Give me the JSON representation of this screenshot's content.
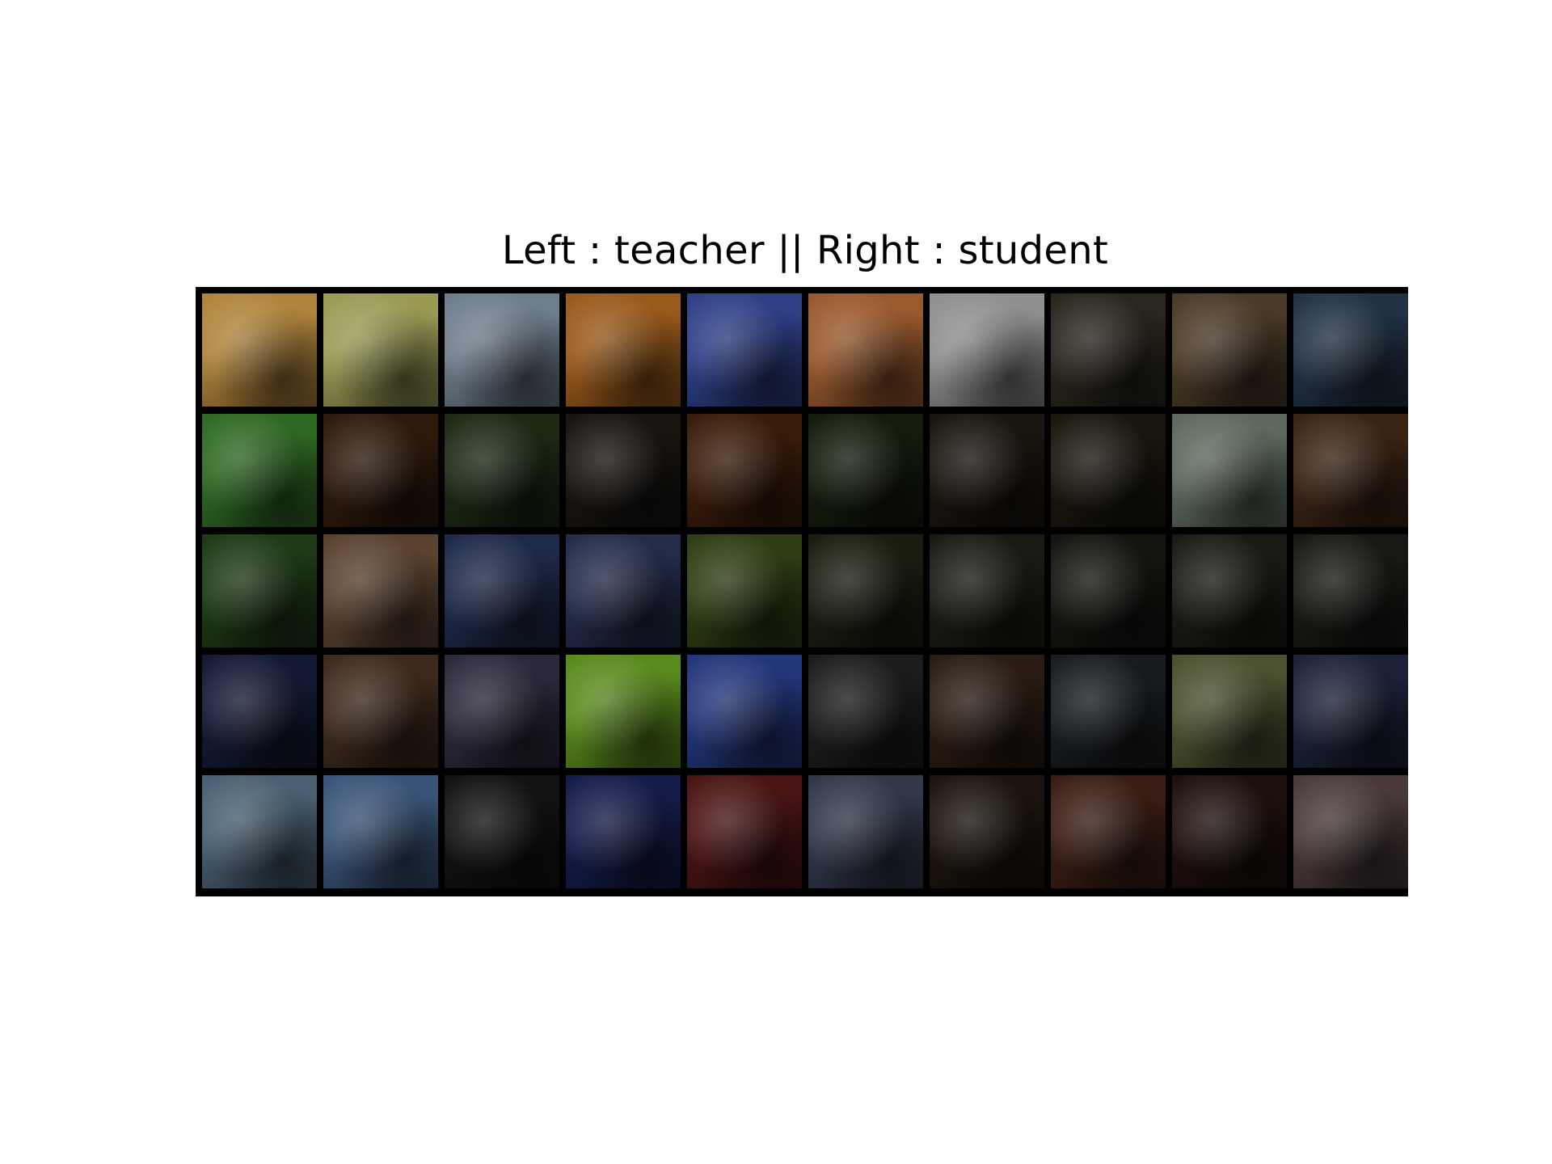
{
  "title": "Left : teacher || Right : student",
  "grid": {
    "rows": 5,
    "cols": 10,
    "frame_color": "#000000",
    "tiles": [
      [
        "#b0843c",
        "#9a9a55",
        "#6f7e8c",
        "#9a5a1c",
        "#2e3f86",
        "#9a5a2e",
        "#8f8f8f",
        "#2a261e",
        "#4a3a28",
        "#213245"
      ],
      [
        "#2f6a24",
        "#2e1a0c",
        "#1c2a14",
        "#181410",
        "#3a1c0a",
        "#141c0c",
        "#1a140e",
        "#1a160e",
        "#5e6a5e",
        "#3a2414"
      ],
      [
        "#1e3a16",
        "#5a4230",
        "#1e2a4a",
        "#242c4a",
        "#2e3e14",
        "#1a1e10",
        "#1c1a14",
        "#141410",
        "#1c1a14",
        "#181814"
      ],
      [
        "#141a34",
        "#3e2a1c",
        "#2a2a3c",
        "#5a8a1e",
        "#23367a",
        "#1c1c1c",
        "#2a1c12",
        "#181c20",
        "#4a5230",
        "#1c2238"
      ],
      [
        "#4a6072",
        "#3a5478",
        "#141210",
        "#141c4a",
        "#4a1414",
        "#30384a",
        "#1c140e",
        "#3a1e14",
        "#1e100c",
        "#4a3a3a"
      ]
    ]
  }
}
